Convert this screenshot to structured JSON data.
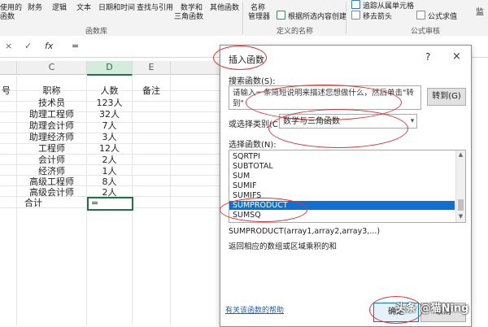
{
  "ribbon": {
    "buttons": [
      "使用的",
      "财务",
      "逻辑",
      "文本",
      "日期和时间",
      "查找与引用",
      "数学和",
      "其他函数",
      "名称",
      "管理器"
    ],
    "math_second_line": "三角函数",
    "use_second_line": "函数",
    "group_function_library": "函数库",
    "define_names_item": "根据所选内容创建",
    "group_defined_names": "定义的名称",
    "audit_items": [
      "追踪从属单元格",
      "移去箭头",
      "公式求值"
    ],
    "group_formula_audit": "公式审核",
    "watch_label": "监"
  },
  "formula_bar": {
    "cancel_icon": "×",
    "enter_icon": "✓",
    "fx_label": "fx",
    "content": "="
  },
  "sheet": {
    "columns": [
      "C",
      "D",
      "E"
    ],
    "headers": {
      "b_partial": "号",
      "c": "职称",
      "d": "人数",
      "e": "备注"
    },
    "rows": [
      {
        "title": "技术员",
        "count": "123人"
      },
      {
        "title": "助理工程师",
        "count": "32人"
      },
      {
        "title": "助理会计师",
        "count": "7人"
      },
      {
        "title": "助理经济师",
        "count": "3人"
      },
      {
        "title": "工程师",
        "count": "12人"
      },
      {
        "title": "会计师",
        "count": "2人"
      },
      {
        "title": "经济师",
        "count": "1人"
      },
      {
        "title": "高级工程师",
        "count": "8人"
      },
      {
        "title": "高级会计师",
        "count": "2人"
      }
    ],
    "total_label": "合计",
    "active_cell_value": "="
  },
  "dialog": {
    "title": "插入函数",
    "help_icon": "?",
    "close_icon": "×",
    "search_label": "搜索函数(S):",
    "search_placeholder": "请输入一条简短说明来描述您想做什么，然后单击\"转到\"",
    "goto_button": "转到(G)",
    "category_label": "或选择类别(C):",
    "category_value": "数学与三角函数",
    "select_label": "选择函数(N):",
    "functions": [
      "SQRTPI",
      "SUBTOTAL",
      "SUM",
      "SUMIF",
      "SUMIFS",
      "SUMPRODUCT",
      "SUMSQ"
    ],
    "selected_function": "SUMPRODUCT",
    "signature": "SUMPRODUCT(array1,array2,array3,...)",
    "description": "返回相应的数组或区域乘积的和",
    "help_link": "有关该函数的帮助",
    "ok_button": "确定",
    "cancel_button": "取消"
  },
  "watermark": "头条 @猫Ning",
  "colors": {
    "selection": "#1170cf",
    "excel_green": "#217346",
    "annotation_red": "#e03333"
  }
}
